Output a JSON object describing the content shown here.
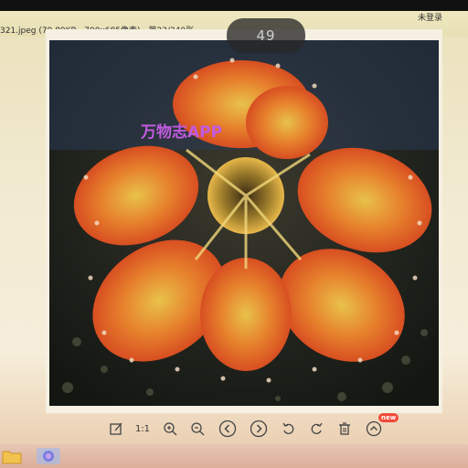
{
  "window": {
    "file_info": "321.jpeg (79.89KB , 700x685像素) - 第23/240张",
    "login_label": "未登录",
    "page_counter": "49"
  },
  "image": {
    "watermark": "万物志APP",
    "subject": "sundew-plant-photo"
  },
  "toolbar": {
    "items": [
      {
        "name": "edit-icon"
      },
      {
        "name": "actual-size",
        "label": "1:1"
      },
      {
        "name": "zoom-in-icon"
      },
      {
        "name": "zoom-out-icon"
      },
      {
        "name": "previous-icon"
      },
      {
        "name": "next-icon"
      },
      {
        "name": "rotate-left-icon"
      },
      {
        "name": "rotate-right-icon"
      },
      {
        "name": "delete-icon"
      },
      {
        "name": "more-icon"
      }
    ],
    "new_badge": "new"
  },
  "taskbar": {
    "icons": [
      "folder-icon",
      "app-icon"
    ]
  },
  "colors": {
    "accent_badge": "#f04a3a",
    "watermark": "#c25be0",
    "counter_bg": "#282828"
  }
}
